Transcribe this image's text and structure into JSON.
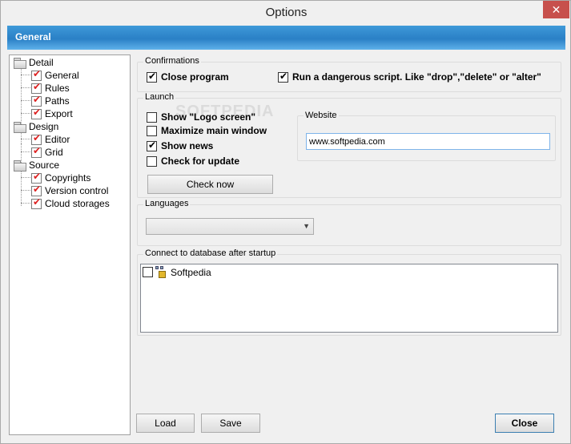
{
  "window": {
    "title": "Options",
    "close_glyph": "✕"
  },
  "header": {
    "title": "General"
  },
  "tree": {
    "items": [
      {
        "label": "Detail",
        "type": "folder"
      },
      {
        "label": "General",
        "type": "check"
      },
      {
        "label": "Rules",
        "type": "check"
      },
      {
        "label": "Paths",
        "type": "check"
      },
      {
        "label": "Export",
        "type": "check"
      },
      {
        "label": "Design",
        "type": "folder"
      },
      {
        "label": "Editor",
        "type": "check"
      },
      {
        "label": "Grid",
        "type": "check"
      },
      {
        "label": "Source",
        "type": "folder"
      },
      {
        "label": "Copyrights",
        "type": "check"
      },
      {
        "label": "Version control",
        "type": "check"
      },
      {
        "label": "Cloud storages",
        "type": "check"
      }
    ]
  },
  "confirmations": {
    "label": "Confirmations",
    "close_program": {
      "label": "Close program",
      "checked": true
    },
    "dangerous_script": {
      "label": "Run a dangerous script. Like \"drop\",\"delete\" or \"alter\"",
      "checked": true
    }
  },
  "launch": {
    "label": "Launch",
    "show_logo": {
      "label": "Show \"Logo screen\"",
      "checked": false
    },
    "maximize": {
      "label": "Maximize main window",
      "checked": false
    },
    "show_news": {
      "label": "Show news",
      "checked": true
    },
    "check_update": {
      "label": "Check for update",
      "checked": false
    },
    "check_now_button": "Check now",
    "website": {
      "label": "Website",
      "value": "www.softpedia.com"
    }
  },
  "languages": {
    "label": "Languages",
    "selected": ""
  },
  "connect": {
    "label": "Connect to database after startup",
    "items": [
      {
        "label": "Softpedia",
        "checked": false
      }
    ]
  },
  "footer": {
    "load": "Load",
    "save": "Save",
    "close": "Close"
  },
  "watermark": "SOFTPEDIA"
}
